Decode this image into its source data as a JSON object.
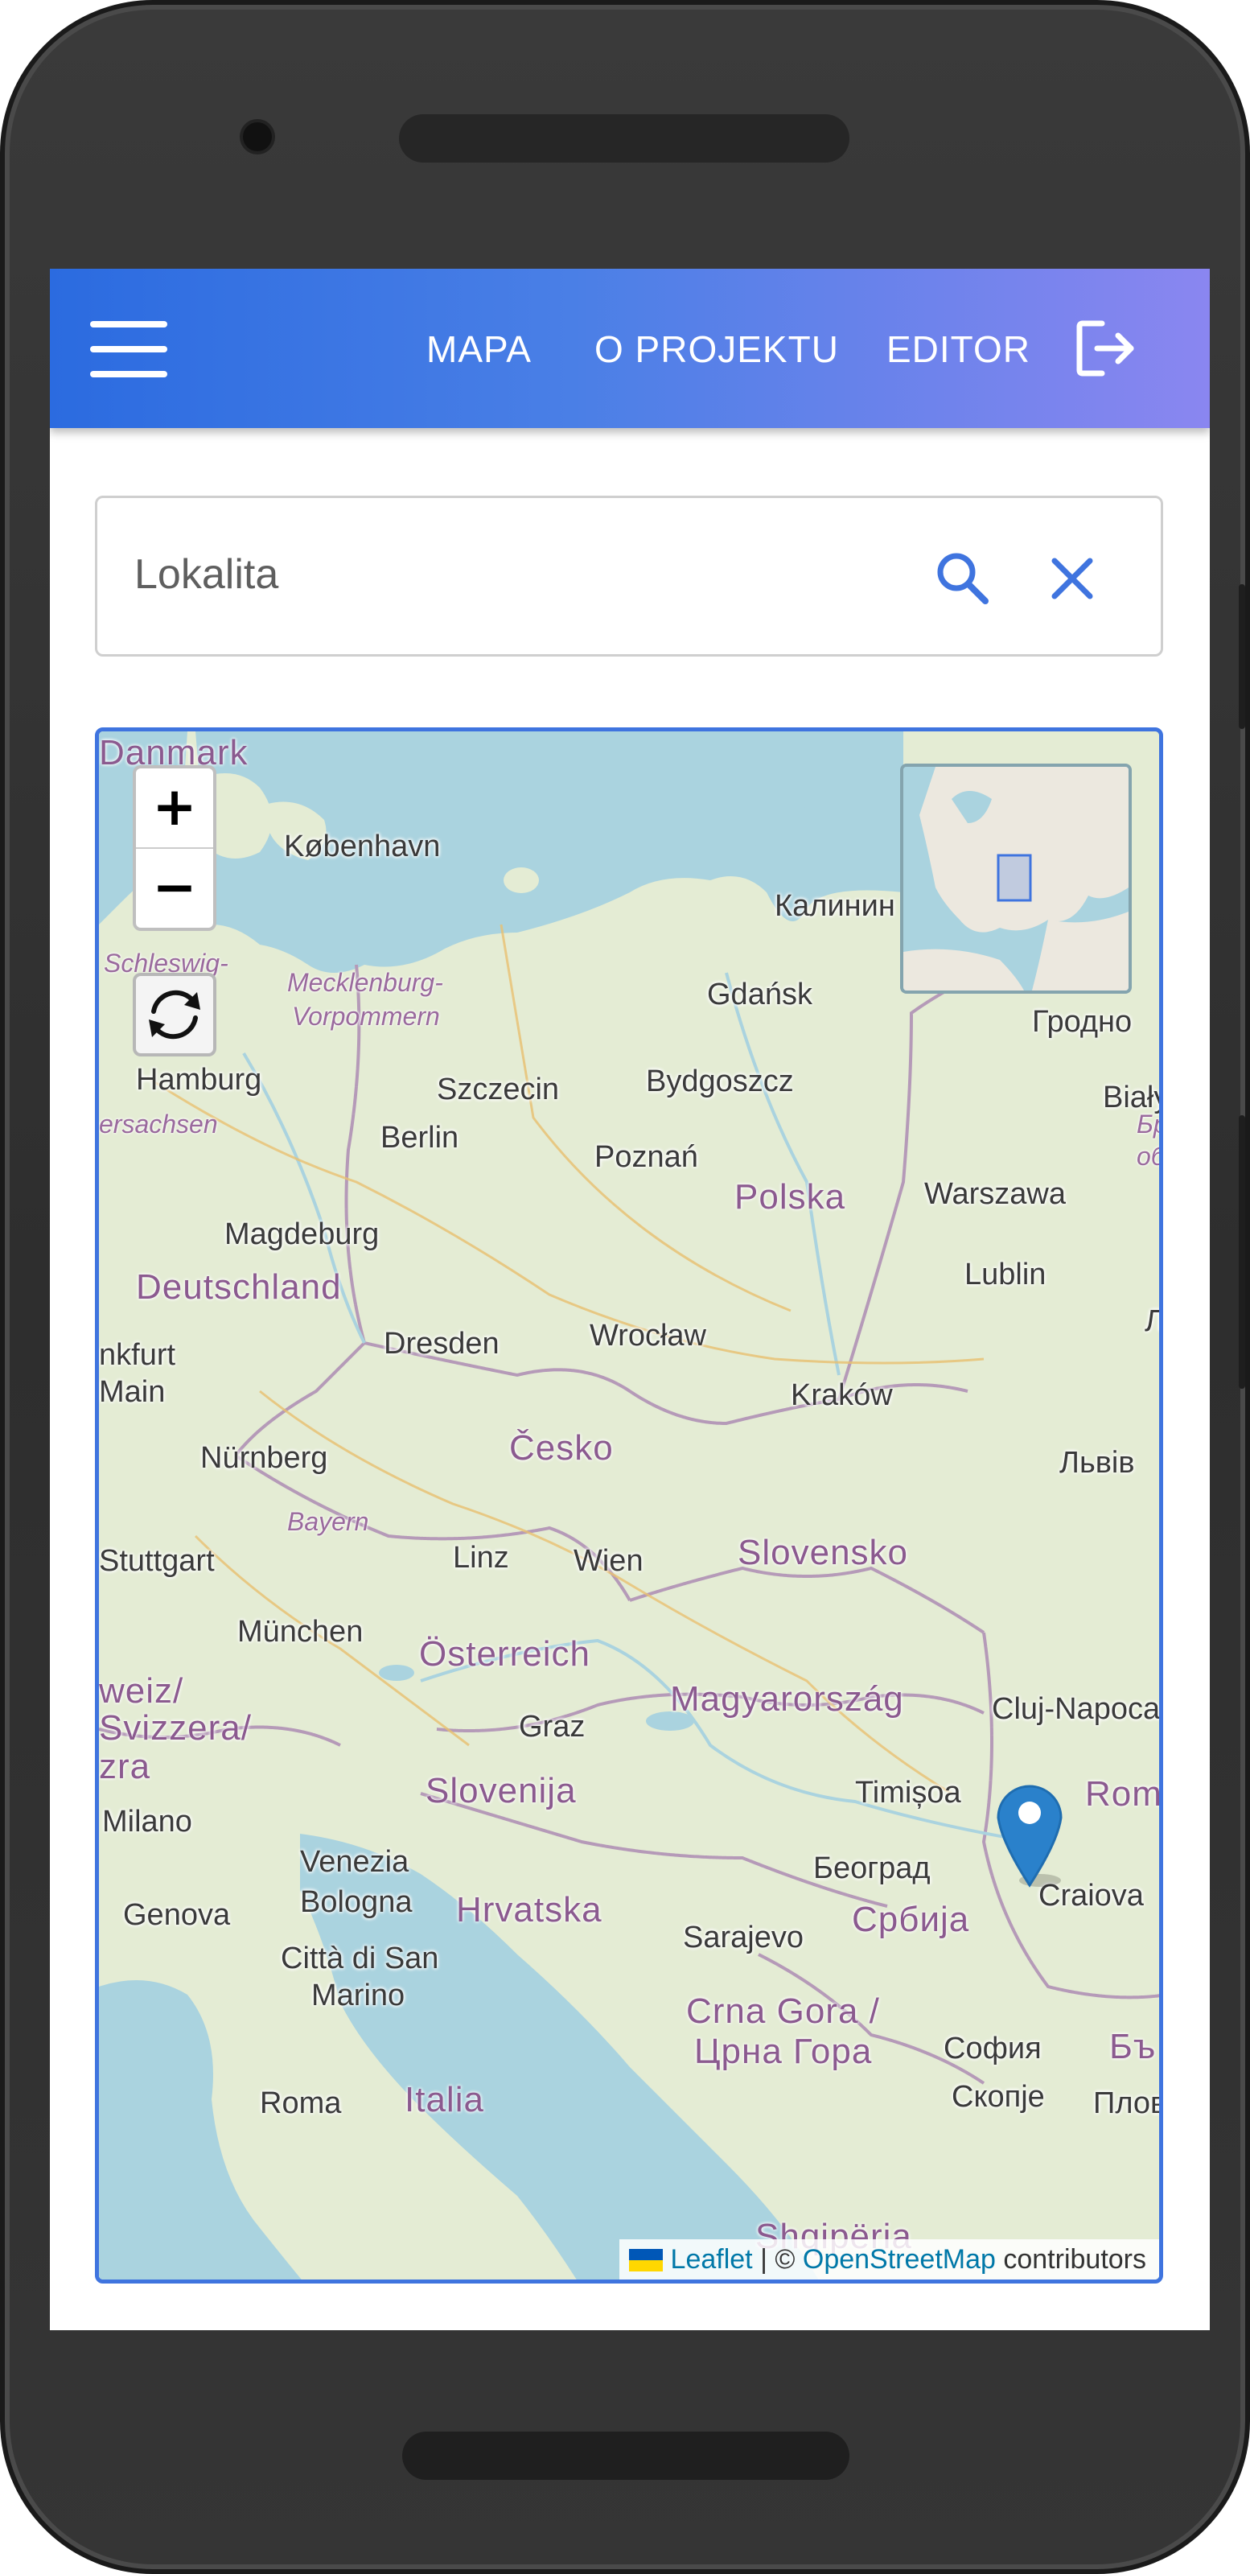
{
  "appbar": {
    "nav": [
      {
        "label": "MAPA"
      },
      {
        "label": "O PROJEKTU"
      },
      {
        "label": "EDITOR"
      }
    ]
  },
  "search": {
    "placeholder": "Lokalita",
    "value": ""
  },
  "map": {
    "zoom_in": "+",
    "zoom_out": "−",
    "attribution": {
      "leaflet": "Leaflet",
      "separator": "| ©",
      "osm": "OpenStreetMap",
      "suffix": "contributors"
    },
    "countries": [
      "Danmark",
      "Deutschland",
      "Polska",
      "Česko",
      "Slovensko",
      "Österreich",
      "Magyarország",
      "Slovenija",
      "Hrvatska",
      "Србија",
      "Crna Gora /",
      "Црна Гора",
      "Italia",
      "Româ",
      "Бъ",
      "weiz/",
      "Svizzera/",
      "zra"
    ],
    "regions": [
      "Schleswig-",
      "Mecklenburg-",
      "Vorpommern",
      "ersachsen",
      "Bayern",
      "Брє",
      "обл"
    ],
    "cities": [
      "København",
      "Калинин",
      "Gdańsk",
      "Гродно",
      "Hamburg",
      "Szczecin",
      "Bydgoszcz",
      "Białyst",
      "Berlin",
      "Poznań",
      "Warszawa",
      "Magdeburg",
      "Lublin",
      "nkfurt",
      "Main",
      "Dresden",
      "Wrocław",
      "Kraków",
      "Л",
      "Nürnberg",
      "Львів",
      "Stuttgart",
      "Linz",
      "Wien",
      "München",
      "Graz",
      "Cluj-Napoca",
      "Timișoa",
      "Milano",
      "Venezia",
      "Београд",
      "Genova",
      "Bologna",
      "Craiova",
      "Sarajevo",
      "Città di San",
      "Marino",
      "София",
      "Скопје",
      "Плов",
      "Roma",
      "Shqipëria"
    ]
  },
  "colors": {
    "appbar_start": "#2b6be0",
    "appbar_end": "#8a86f0",
    "accent": "#3f74df",
    "marker": "#2a81cb",
    "water": "#aad3df",
    "land": "#e4ecd4"
  }
}
